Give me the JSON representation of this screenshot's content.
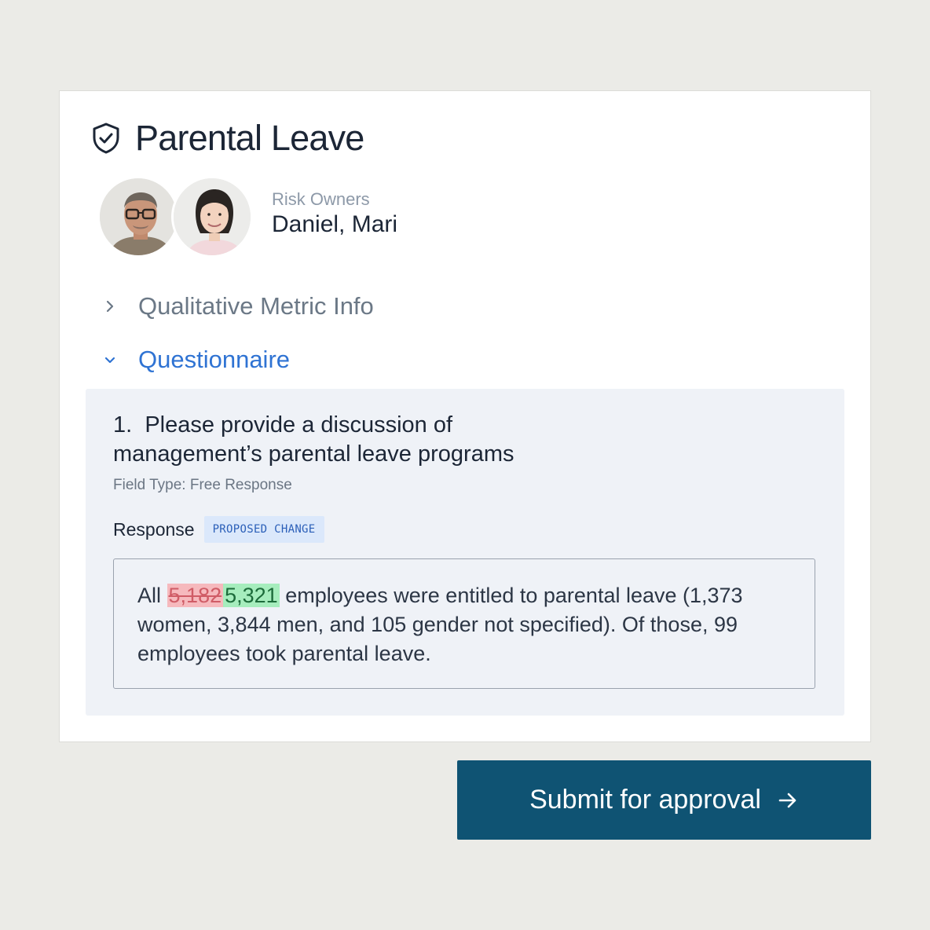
{
  "header": {
    "title": "Parental Leave",
    "icon": "shield-check-icon"
  },
  "owners": {
    "label": "Risk Owners",
    "names": "Daniel, Mari",
    "avatars": [
      "Daniel",
      "Mari"
    ]
  },
  "sections": [
    {
      "label": "Qualitative Metric Info",
      "expanded": false,
      "icon": "chevron-right-icon"
    },
    {
      "label": "Questionnaire",
      "expanded": true,
      "icon": "chevron-down-icon"
    }
  ],
  "question": {
    "number": "1.",
    "text": "Please provide a discussion of management’s parental leave programs",
    "field_type": "Field Type: Free Response",
    "response_label": "Response",
    "badge": "PROPOSED CHANGE"
  },
  "response": {
    "prefix": "All",
    "old_value": "5,182",
    "new_value": "5,321",
    "rest": "employees were entitled to parental leave (1,373 women, 3,844 men, and 105 gender not specified). Of those, 99 employees took parental leave."
  },
  "actions": {
    "submit_label": "Submit for approval",
    "submit_icon": "arrow-right-icon"
  },
  "colors": {
    "accent": "#2f73d3",
    "button": "#0f5373",
    "deleted_bg": "#f6b9bd",
    "inserted_bg": "#a6edbd"
  }
}
